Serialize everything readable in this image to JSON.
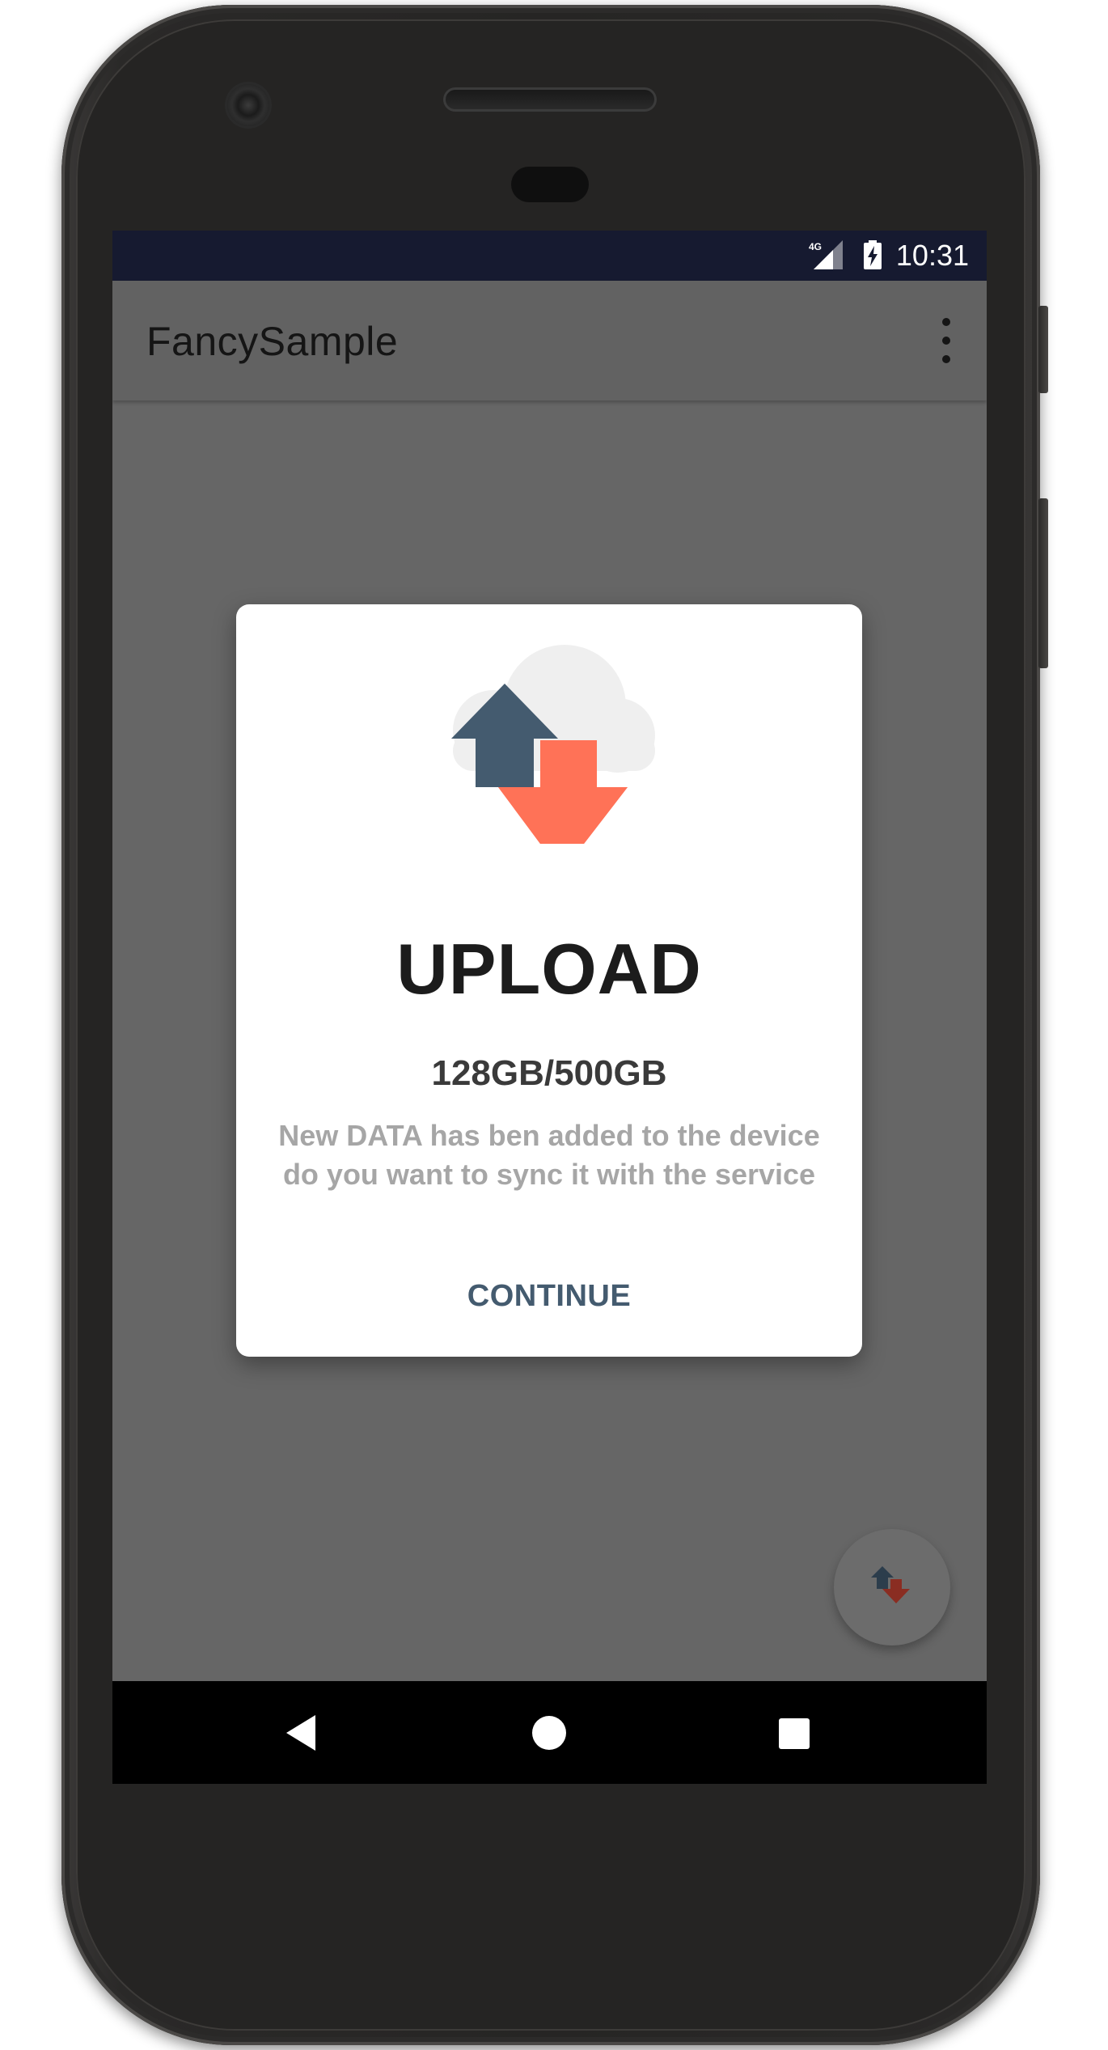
{
  "status_bar": {
    "network": "4G",
    "time": "10:31"
  },
  "app_bar": {
    "title": "FancySample",
    "overflow_icon": "more-vert-icon"
  },
  "dialog": {
    "icon": "cloud-upload-download-icon",
    "title": "UPLOAD",
    "subtitle": "128GB/500GB",
    "message": "New DATA has ben added to the device do you want to sync it with the service",
    "button_label": "CONTINUE"
  },
  "fab": {
    "icon": "upload-download-icon"
  },
  "nav_bar": {
    "back_icon": "back-triangle-icon",
    "home_icon": "home-circle-icon",
    "recents_icon": "recents-square-icon"
  },
  "colors": {
    "status_bar": "#161a30",
    "scrim": "#666666",
    "arrow_up": "#445b6f",
    "arrow_down": "#ff7257",
    "cloud": "#efefef",
    "button_text": "#445b6f"
  }
}
